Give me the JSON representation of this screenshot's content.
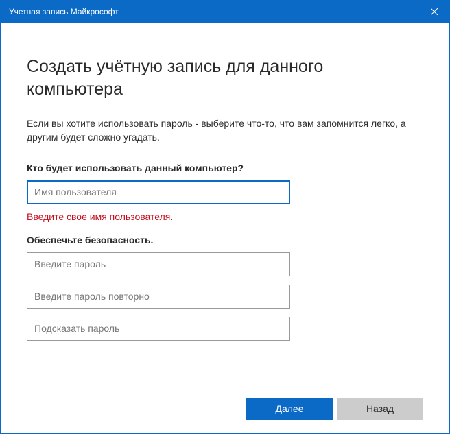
{
  "titlebar": {
    "title": "Учетная запись Майкрософт"
  },
  "main": {
    "heading": "Создать учётную запись для данного компьютера",
    "description": "Если вы хотите использовать пароль - выберите что-то, что вам запомнится легко, а другим будет сложно угадать.",
    "section1_label": "Кто будет использовать данный компьютер?",
    "username_placeholder": "Имя пользователя",
    "username_value": "",
    "error_message": "Введите свое имя пользователя.",
    "section2_label": "Обеспечьте безопасность.",
    "password1_placeholder": "Введите пароль",
    "password2_placeholder": "Введите пароль повторно",
    "hint_placeholder": "Подсказать пароль"
  },
  "footer": {
    "next_label": "Далее",
    "back_label": "Назад"
  }
}
